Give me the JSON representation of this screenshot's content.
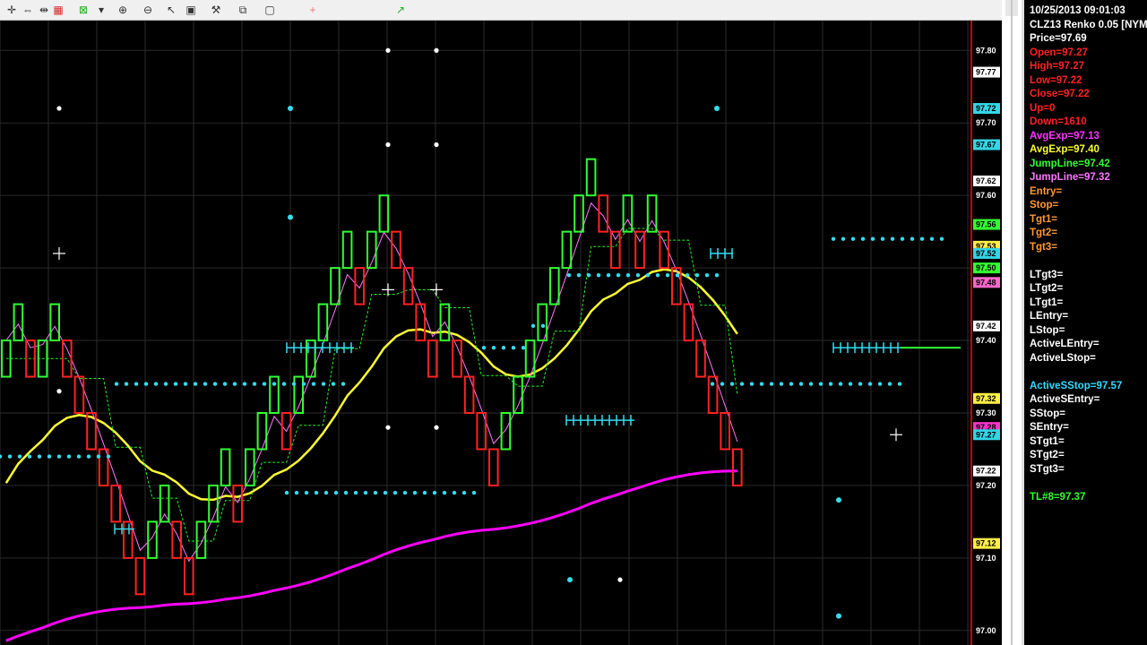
{
  "toolbar": {
    "icons": [
      "crosshair-icon",
      "cursor-icon",
      "cross-cursor-icon",
      "chart-icon",
      "grid-icon",
      "dropdown-icon",
      "zoom-in-icon",
      "zoom-out-icon",
      "select-icon",
      "tool-icon",
      "hammer-icon",
      "window-icon",
      "rect-icon",
      "plus-icon",
      "trend-icon"
    ]
  },
  "chart_data": {
    "type": "renko",
    "symbol": "CLZ13 Renko 0.05",
    "ylim": [
      96.98,
      97.83
    ],
    "yaxis_ticks": [
      "97.80",
      "97.70",
      "97.60",
      "97.40",
      "97.30",
      "97.20",
      "97.10",
      "97.00"
    ],
    "price_tags": [
      {
        "label": "97.77",
        "bg": "#ffffff",
        "fg": "#000000"
      },
      {
        "label": "97.72",
        "bg": "#33d6e6",
        "fg": "#000000"
      },
      {
        "label": "97.67",
        "bg": "#33d6e6",
        "fg": "#000000"
      },
      {
        "label": "97.62",
        "bg": "#ffffff",
        "fg": "#000000"
      },
      {
        "label": "97.56",
        "bg": "#33ff33",
        "fg": "#000000"
      },
      {
        "label": "97.53",
        "bg": "#ffee44",
        "fg": "#000000"
      },
      {
        "label": "97.52",
        "bg": "#33d6e6",
        "fg": "#000000"
      },
      {
        "label": "97.50",
        "bg": "#33ff33",
        "fg": "#000000"
      },
      {
        "label": "97.48",
        "bg": "#ff66cc",
        "fg": "#000000"
      },
      {
        "label": "97.42",
        "bg": "#ffffff",
        "fg": "#000000"
      },
      {
        "label": "97.32",
        "bg": "#ffee44",
        "fg": "#000000"
      },
      {
        "label": "97.28",
        "bg": "#ff33cc",
        "fg": "#000000"
      },
      {
        "label": "97.27",
        "bg": "#33d6e6",
        "fg": "#000000"
      },
      {
        "label": "97.22",
        "bg": "#ffffff",
        "fg": "#000000"
      },
      {
        "label": "97.12",
        "bg": "#ffee44",
        "fg": "#000000"
      }
    ],
    "bricks": [
      {
        "x": 0,
        "dir": 1,
        "low": 97.35,
        "high": 97.4
      },
      {
        "x": 1,
        "dir": 1,
        "low": 97.4,
        "high": 97.45
      },
      {
        "x": 2,
        "dir": -1,
        "low": 97.35,
        "high": 97.4
      },
      {
        "x": 3,
        "dir": 1,
        "low": 97.35,
        "high": 97.4
      },
      {
        "x": 4,
        "dir": 1,
        "low": 97.4,
        "high": 97.45
      },
      {
        "x": 5,
        "dir": -1,
        "low": 97.35,
        "high": 97.4
      },
      {
        "x": 6,
        "dir": -1,
        "low": 97.3,
        "high": 97.35
      },
      {
        "x": 7,
        "dir": -1,
        "low": 97.25,
        "high": 97.3
      },
      {
        "x": 8,
        "dir": -1,
        "low": 97.2,
        "high": 97.25
      },
      {
        "x": 9,
        "dir": -1,
        "low": 97.15,
        "high": 97.2
      },
      {
        "x": 10,
        "dir": -1,
        "low": 97.1,
        "high": 97.15
      },
      {
        "x": 11,
        "dir": -1,
        "low": 97.05,
        "high": 97.1
      },
      {
        "x": 12,
        "dir": 1,
        "low": 97.1,
        "high": 97.15
      },
      {
        "x": 13,
        "dir": 1,
        "low": 97.15,
        "high": 97.2
      },
      {
        "x": 14,
        "dir": -1,
        "low": 97.1,
        "high": 97.15
      },
      {
        "x": 15,
        "dir": -1,
        "low": 97.05,
        "high": 97.1
      },
      {
        "x": 16,
        "dir": 1,
        "low": 97.1,
        "high": 97.15
      },
      {
        "x": 17,
        "dir": 1,
        "low": 97.15,
        "high": 97.2
      },
      {
        "x": 18,
        "dir": 1,
        "low": 97.2,
        "high": 97.25
      },
      {
        "x": 19,
        "dir": -1,
        "low": 97.15,
        "high": 97.2
      },
      {
        "x": 20,
        "dir": 1,
        "low": 97.2,
        "high": 97.25
      },
      {
        "x": 21,
        "dir": 1,
        "low": 97.25,
        "high": 97.3
      },
      {
        "x": 22,
        "dir": 1,
        "low": 97.3,
        "high": 97.35
      },
      {
        "x": 23,
        "dir": -1,
        "low": 97.25,
        "high": 97.3
      },
      {
        "x": 24,
        "dir": 1,
        "low": 97.3,
        "high": 97.35
      },
      {
        "x": 25,
        "dir": 1,
        "low": 97.35,
        "high": 97.4
      },
      {
        "x": 26,
        "dir": 1,
        "low": 97.4,
        "high": 97.45
      },
      {
        "x": 27,
        "dir": 1,
        "low": 97.45,
        "high": 97.5
      },
      {
        "x": 28,
        "dir": 1,
        "low": 97.5,
        "high": 97.55
      },
      {
        "x": 29,
        "dir": -1,
        "low": 97.45,
        "high": 97.5
      },
      {
        "x": 30,
        "dir": 1,
        "low": 97.5,
        "high": 97.55
      },
      {
        "x": 31,
        "dir": 1,
        "low": 97.55,
        "high": 97.6
      },
      {
        "x": 32,
        "dir": -1,
        "low": 97.5,
        "high": 97.55
      },
      {
        "x": 33,
        "dir": -1,
        "low": 97.45,
        "high": 97.5
      },
      {
        "x": 34,
        "dir": -1,
        "low": 97.4,
        "high": 97.45
      },
      {
        "x": 35,
        "dir": -1,
        "low": 97.35,
        "high": 97.4
      },
      {
        "x": 36,
        "dir": 1,
        "low": 97.4,
        "high": 97.45
      },
      {
        "x": 37,
        "dir": -1,
        "low": 97.35,
        "high": 97.4
      },
      {
        "x": 38,
        "dir": -1,
        "low": 97.3,
        "high": 97.35
      },
      {
        "x": 39,
        "dir": -1,
        "low": 97.25,
        "high": 97.3
      },
      {
        "x": 40,
        "dir": -1,
        "low": 97.2,
        "high": 97.25
      },
      {
        "x": 41,
        "dir": 1,
        "low": 97.25,
        "high": 97.3
      },
      {
        "x": 42,
        "dir": 1,
        "low": 97.3,
        "high": 97.35
      },
      {
        "x": 43,
        "dir": 1,
        "low": 97.35,
        "high": 97.4
      },
      {
        "x": 44,
        "dir": 1,
        "low": 97.4,
        "high": 97.45
      },
      {
        "x": 45,
        "dir": 1,
        "low": 97.45,
        "high": 97.5
      },
      {
        "x": 46,
        "dir": 1,
        "low": 97.5,
        "high": 97.55
      },
      {
        "x": 47,
        "dir": 1,
        "low": 97.55,
        "high": 97.6
      },
      {
        "x": 48,
        "dir": 1,
        "low": 97.6,
        "high": 97.65
      },
      {
        "x": 49,
        "dir": -1,
        "low": 97.55,
        "high": 97.6
      },
      {
        "x": 50,
        "dir": -1,
        "low": 97.5,
        "high": 97.55
      },
      {
        "x": 51,
        "dir": 1,
        "low": 97.55,
        "high": 97.6
      },
      {
        "x": 52,
        "dir": -1,
        "low": 97.5,
        "high": 97.55
      },
      {
        "x": 53,
        "dir": 1,
        "low": 97.55,
        "high": 97.6
      },
      {
        "x": 54,
        "dir": -1,
        "low": 97.5,
        "high": 97.55
      },
      {
        "x": 55,
        "dir": -1,
        "low": 97.45,
        "high": 97.5
      },
      {
        "x": 56,
        "dir": -1,
        "low": 97.4,
        "high": 97.45
      },
      {
        "x": 57,
        "dir": -1,
        "low": 97.35,
        "high": 97.4
      },
      {
        "x": 58,
        "dir": -1,
        "low": 97.3,
        "high": 97.35
      },
      {
        "x": 59,
        "dir": -1,
        "low": 97.25,
        "high": 97.3
      },
      {
        "x": 60,
        "dir": -1,
        "low": 97.2,
        "high": 97.25
      }
    ],
    "avgexp_fast": {
      "name": "AvgExp",
      "color": "#ff00ff",
      "value": 97.13
    },
    "avgexp_slow": {
      "name": "AvgExp",
      "color": "#ffff33",
      "value": 97.4
    },
    "jumpline_fast": {
      "name": "JumpLine",
      "color": "#22ee22",
      "value": 97.42
    },
    "jumpline_slow": {
      "name": "JumpLine",
      "color": "#ff77ff",
      "value": 97.32
    }
  },
  "info": {
    "lines": [
      {
        "text": "10/25/2013 09:01:03",
        "color": "#ffffff"
      },
      {
        "text": "CLZ13 Renko 0.05 [NYM",
        "color": "#ffffff"
      },
      {
        "text": "Price=97.69",
        "color": "#ffffff"
      },
      {
        "text": "Open=97.27",
        "color": "#ff2222"
      },
      {
        "text": "High=97.27",
        "color": "#ff2222"
      },
      {
        "text": "Low=97.22",
        "color": "#ff2222"
      },
      {
        "text": "Close=97.22",
        "color": "#ff2222"
      },
      {
        "text": "Up=0",
        "color": "#ff2222"
      },
      {
        "text": "Down=1610",
        "color": "#ff2222"
      },
      {
        "text": "AvgExp=97.13",
        "color": "#ff33ff"
      },
      {
        "text": "AvgExp=97.40",
        "color": "#ffff33"
      },
      {
        "text": "JumpLine=97.42",
        "color": "#33ff33"
      },
      {
        "text": "JumpLine=97.32",
        "color": "#ff77ff"
      },
      {
        "text": "Entry=",
        "color": "#ff9933"
      },
      {
        "text": "Stop=",
        "color": "#ff9933"
      },
      {
        "text": "Tgt1=",
        "color": "#ff9933"
      },
      {
        "text": "Tgt2=",
        "color": "#ff9933"
      },
      {
        "text": "Tgt3=",
        "color": "#ff9933"
      },
      {
        "text": "",
        "color": "#ffffff"
      },
      {
        "text": "LTgt3=",
        "color": "#ffffff"
      },
      {
        "text": "LTgt2=",
        "color": "#ffffff"
      },
      {
        "text": "LTgt1=",
        "color": "#ffffff"
      },
      {
        "text": "LEntry=",
        "color": "#ffffff"
      },
      {
        "text": "LStop=",
        "color": "#ffffff"
      },
      {
        "text": "ActiveLEntry=",
        "color": "#ffffff"
      },
      {
        "text": "ActiveLStop=",
        "color": "#ffffff"
      },
      {
        "text": "",
        "color": "#ffffff"
      },
      {
        "text": "ActiveSStop=97.57",
        "color": "#33ddff"
      },
      {
        "text": "ActiveSEntry=",
        "color": "#ffffff"
      },
      {
        "text": "SStop=",
        "color": "#ffffff"
      },
      {
        "text": "SEntry=",
        "color": "#ffffff"
      },
      {
        "text": "STgt1=",
        "color": "#ffffff"
      },
      {
        "text": "STgt2=",
        "color": "#ffffff"
      },
      {
        "text": "STgt3=",
        "color": "#ffffff"
      },
      {
        "text": "",
        "color": "#ffffff"
      },
      {
        "text": "TL#8=97.37",
        "color": "#33ff33"
      }
    ]
  }
}
